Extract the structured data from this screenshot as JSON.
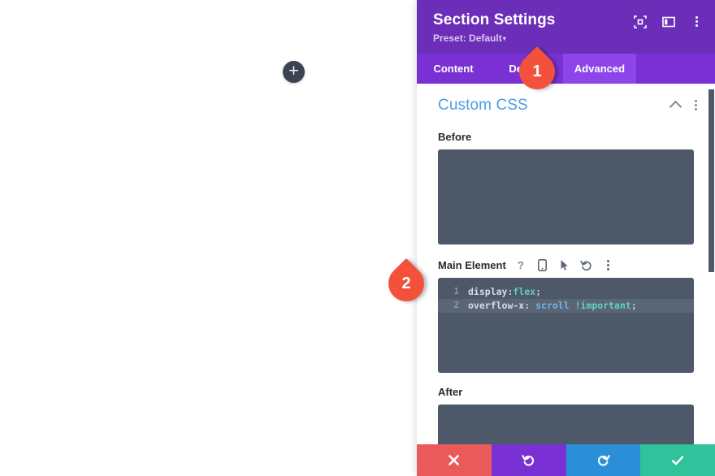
{
  "canvas": {
    "add_section_button": {
      "label": "+",
      "icon": "plus-icon"
    }
  },
  "panel": {
    "header": {
      "title": "Section Settings",
      "preset_label": "Preset: Default",
      "preset_caret": "▾",
      "icons": [
        {
          "name": "focus-frame-icon"
        },
        {
          "name": "layout-panel-icon"
        },
        {
          "name": "more-vertical-icon"
        }
      ]
    },
    "tabs": [
      {
        "id": "content",
        "label": "Content",
        "active": false
      },
      {
        "id": "design",
        "label": "Design",
        "active": false
      },
      {
        "id": "advanced",
        "label": "Advanced",
        "active": true
      }
    ],
    "section": {
      "title": "Custom CSS",
      "collapse_icon": "chevron-up-icon",
      "menu_icon": "more-vertical-icon"
    },
    "fields": {
      "before": {
        "label": "Before",
        "value": ""
      },
      "main_element": {
        "label": "Main Element",
        "icons": [
          {
            "name": "help-icon",
            "glyph": "?"
          },
          {
            "name": "responsive-mobile-icon",
            "glyph": ""
          },
          {
            "name": "hover-cursor-icon",
            "glyph": ""
          },
          {
            "name": "reset-undo-icon",
            "glyph": ""
          },
          {
            "name": "more-vertical-icon",
            "glyph": ""
          }
        ],
        "code_lines": [
          {
            "number": "1",
            "highlight": false,
            "tokens": [
              {
                "text": "display",
                "type": "prop"
              },
              {
                "text": ":",
                "type": "punc"
              },
              {
                "text": "flex",
                "type": "val-teal"
              },
              {
                "text": ";",
                "type": "punc"
              }
            ]
          },
          {
            "number": "2",
            "highlight": true,
            "tokens": [
              {
                "text": "overflow-x",
                "type": "prop"
              },
              {
                "text": ": ",
                "type": "punc"
              },
              {
                "text": "scroll",
                "type": "val-blue"
              },
              {
                "text": " ",
                "type": "punc"
              },
              {
                "text": "!important",
                "type": "val-teal"
              },
              {
                "text": ";",
                "type": "punc"
              }
            ]
          }
        ]
      },
      "after": {
        "label": "After",
        "value": ""
      }
    },
    "footer": {
      "buttons": [
        {
          "id": "cancel",
          "icon": "close-x-icon",
          "color": "#eb5a5a"
        },
        {
          "id": "undo",
          "icon": "undo-arrow-icon",
          "color": "#7a31d4"
        },
        {
          "id": "redo",
          "icon": "redo-arrow-icon",
          "color": "#2b8fd8"
        },
        {
          "id": "save",
          "icon": "checkmark-icon",
          "color": "#2fc29b"
        }
      ]
    },
    "scrollbar": {
      "name": "panel-scrollbar"
    }
  },
  "callouts": [
    {
      "id": "callout-1",
      "number": "1"
    },
    {
      "id": "callout-2",
      "number": "2"
    }
  ],
  "colors": {
    "header_purple": "#6c2eb9",
    "tabs_purple": "#7a31d4",
    "tab_active_purple": "#8d44e8",
    "section_title_blue": "#4f9ee0",
    "code_bg": "#4d5868",
    "callout_red": "#f4513c"
  }
}
